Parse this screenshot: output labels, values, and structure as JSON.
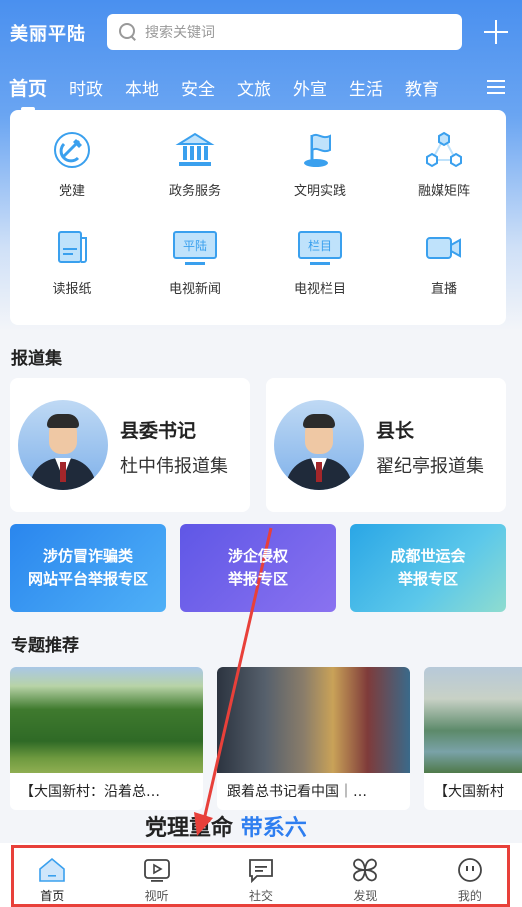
{
  "header": {
    "logo": "美丽平陆",
    "search_placeholder": "搜索关键词"
  },
  "tabs": [
    "首页",
    "时政",
    "本地",
    "安全",
    "文旅",
    "外宣",
    "生活",
    "教育"
  ],
  "grid": [
    {
      "label": "党建",
      "icon": "party-emblem-icon"
    },
    {
      "label": "政务服务",
      "icon": "government-building-icon"
    },
    {
      "label": "文明实践",
      "icon": "flag-icon"
    },
    {
      "label": "融媒矩阵",
      "icon": "network-nodes-icon"
    },
    {
      "label": "读报纸",
      "icon": "newspaper-icon"
    },
    {
      "label": "电视新闻",
      "icon": "tv-news-icon",
      "screen_text": "平陆"
    },
    {
      "label": "电视栏目",
      "icon": "tv-program-icon",
      "screen_text": "栏目"
    },
    {
      "label": "直播",
      "icon": "video-camera-icon"
    }
  ],
  "report_section": {
    "title": "报道集",
    "cards": [
      {
        "title": "县委书记",
        "subtitle": "杜中伟报道集"
      },
      {
        "title": "县长",
        "subtitle": "翟纪亭报道集"
      }
    ]
  },
  "banners": [
    {
      "line1": "涉仿冒诈骗类",
      "line2": "网站平台举报专区",
      "color": "#2e8ff0"
    },
    {
      "line1": "涉企侵权",
      "line2": "举报专区",
      "color": "#6f5ee8"
    },
    {
      "line1": "成都世运会",
      "line2": "举报专区",
      "color": "#34b4e8"
    }
  ],
  "topics": {
    "title": "专题推荐",
    "items": [
      {
        "text": "【大国新村：沿着总…"
      },
      {
        "text": "跟着总书记看中国｜…"
      },
      {
        "text": "【大国新村"
      }
    ]
  },
  "peek": {
    "black": "党理重命",
    "blue": "带系六"
  },
  "bottom_nav": [
    {
      "label": "首页",
      "icon": "home-icon"
    },
    {
      "label": "视听",
      "icon": "play-icon"
    },
    {
      "label": "社交",
      "icon": "chat-icon"
    },
    {
      "label": "发现",
      "icon": "discover-icon"
    },
    {
      "label": "我的",
      "icon": "profile-icon"
    }
  ],
  "colors": {
    "brand_blue": "#4a90ef",
    "icon_blue": "#3aa0ee",
    "highlight_red": "#e8403a"
  }
}
